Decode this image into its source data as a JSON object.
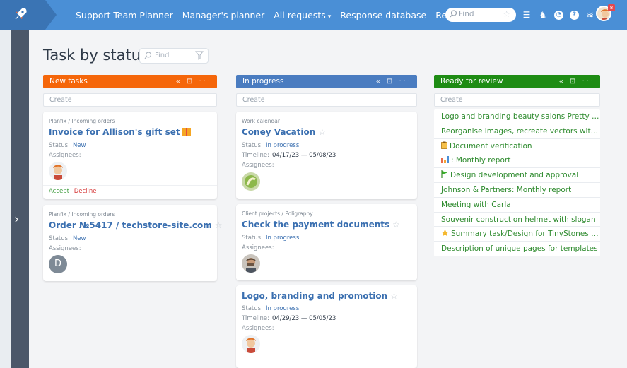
{
  "nav": {
    "items": [
      {
        "label": "Support Team Planner"
      },
      {
        "label": "Manager's planner"
      },
      {
        "label": "All requests",
        "dropdown": true
      },
      {
        "label": "Response database"
      },
      {
        "label": "Reports",
        "dropdown": true
      }
    ],
    "find_placeholder": "Find",
    "badge": "8"
  },
  "page": {
    "title": "Task by status",
    "find_placeholder": "Find"
  },
  "columns": [
    {
      "title": "New tasks",
      "color": "#f5660a",
      "create": "Create"
    },
    {
      "title": "In progress",
      "color": "#4a7cc0",
      "create": "Create"
    },
    {
      "title": "Ready for review",
      "color": "#1e8c14",
      "create": "Create"
    }
  ],
  "cards_new": [
    {
      "project": "Planfix / Incoming orders",
      "title": "Invoice for Allison's gift set",
      "status_label": "Status:",
      "status": "New",
      "assignees_label": "Assignees:",
      "accept": "Accept",
      "decline": "Decline"
    },
    {
      "project": "Planfix / Incoming orders",
      "title": "Order №5417 / techstore-site.com",
      "status_label": "Status:",
      "status": "New",
      "assignees_label": "Assignees:",
      "avatar_letter": "D"
    }
  ],
  "cards_progress": [
    {
      "project": "Work calendar",
      "title": "Coney Vacation",
      "status_label": "Status:",
      "status": "In progress",
      "timeline_label": "Timeline:",
      "timeline": "04/17/23 — 05/08/23",
      "assignees_label": "Assignees:"
    },
    {
      "project": "Client projects / Poligraphy",
      "title": "Check the payment documents",
      "status_label": "Status:",
      "status": "In progress",
      "assignees_label": "Assignees:"
    },
    {
      "title": "Logo, branding and promotion",
      "status_label": "Status:",
      "status": "In progress",
      "timeline_label": "Timeline:",
      "timeline": "04/29/23 — 05/05/23",
      "assignees_label": "Assignees:"
    }
  ],
  "review_items": [
    {
      "label": "Logo and branding beauty salons Pretty Ma...",
      "icon": ""
    },
    {
      "label": "Reorganise images, recreate vectors within...",
      "icon": ""
    },
    {
      "label": "Document verification",
      "icon": "clipboard-icon"
    },
    {
      "label": ": Monthly report",
      "icon": "bar-chart-icon"
    },
    {
      "label": "Design development and approval",
      "icon": "flag-icon"
    },
    {
      "label": "Johnson & Partners: Monthly report",
      "icon": ""
    },
    {
      "label": "Meeting with Carla",
      "icon": ""
    },
    {
      "label": "Souvenir construction helmet with slogan",
      "icon": ""
    },
    {
      "label": "Summary task/Design for TinyStones inc.",
      "icon": "star-icon"
    },
    {
      "label": "Description of unique pages for templates",
      "icon": ""
    }
  ]
}
